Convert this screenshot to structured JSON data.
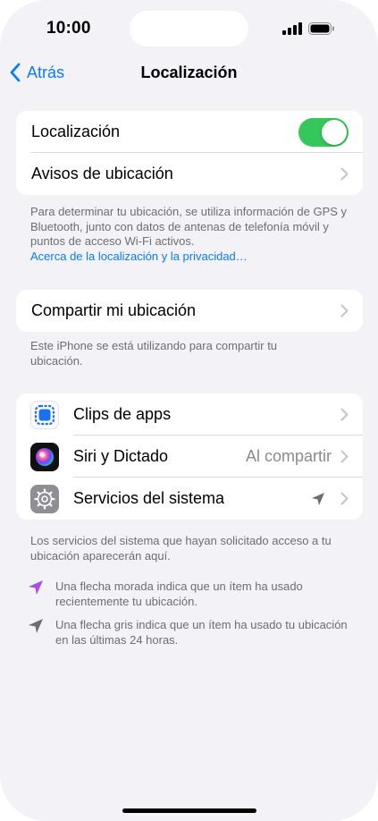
{
  "status_bar": {
    "time": "10:00"
  },
  "nav": {
    "back_label": "Atrás",
    "title": "Localización"
  },
  "group1": {
    "location_label": "Localización",
    "location_enabled": true,
    "alerts_label": "Avisos de ubicación"
  },
  "footnote1": {
    "text": "Para determinar tu ubicación, se utiliza información de GPS y Bluetooth, junto con datos de antenas de telefonía móvil y puntos de acceso Wi-Fi activos.",
    "link": "Acerca de la localización y la privacidad…"
  },
  "group2": {
    "share_label": "Compartir mi ubicación"
  },
  "footnote2": {
    "text": "Este iPhone se está utilizando para compartir tu ubicación."
  },
  "group3": {
    "rows": [
      {
        "label": "Clips de apps",
        "value": "",
        "icon": "app-clips-icon"
      },
      {
        "label": "Siri y Dictado",
        "value": "Al compartir",
        "icon": "siri-icon"
      },
      {
        "label": "Servicios del sistema",
        "value": "",
        "icon": "settings-gear-icon",
        "indicator": "location-arrow-gray-icon"
      }
    ]
  },
  "footnote3": {
    "text": "Los servicios del sistema que hayan solicitado acceso a tu ubicación aparecerán aquí."
  },
  "legend": {
    "purple": "Una flecha morada indica que un ítem ha usado recientemente tu ubicación.",
    "gray": "Una flecha gris indica que un ítem ha usado tu ubicación en las últimas 24 horas."
  },
  "colors": {
    "accent": "#0a7aff",
    "toggle_on": "#34c759",
    "purple_arrow": "#a550e3",
    "gray_arrow": "#6d6d72"
  }
}
